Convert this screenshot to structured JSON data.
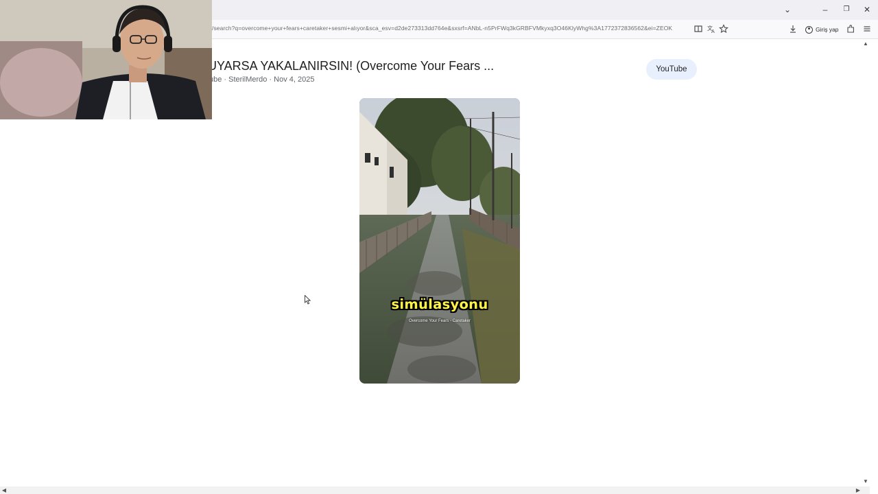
{
  "browser": {
    "url": "/search?q=overcome+your+fears+caretaker+sesmi+alıyor&sca_esv=d2de273313dd764e&sxsrf=ANbL-n5PrFWq3kGRBFVMkyxq3O46KlyWhg%3A1772372836562&ei=ZEOK",
    "signin_label": "Giriş yap",
    "window_controls": {
      "minimize": "–",
      "restore": "❐",
      "close": "✕",
      "tabs_menu": "⌄"
    },
    "icons": [
      "reader-view-icon",
      "translate-icon",
      "bookmark-star-icon",
      "download-icon",
      "extensions-icon",
      "menu-icon"
    ]
  },
  "video": {
    "title": "İ DUYARSA YAKALANIRSIN! (Overcome Your Fears ...",
    "meta": "ube · SterilMerdo · Nov 4, 2025",
    "source_chip": "YouTube",
    "caption": "simülasyonu",
    "subcaption": "Overcome Your Fears - Caretaker"
  },
  "colors": {
    "chip_bg": "#e8f0fe",
    "caption_yellow": "#fff34a",
    "title_text": "#1f1f1f",
    "meta_text": "#5f6368"
  }
}
